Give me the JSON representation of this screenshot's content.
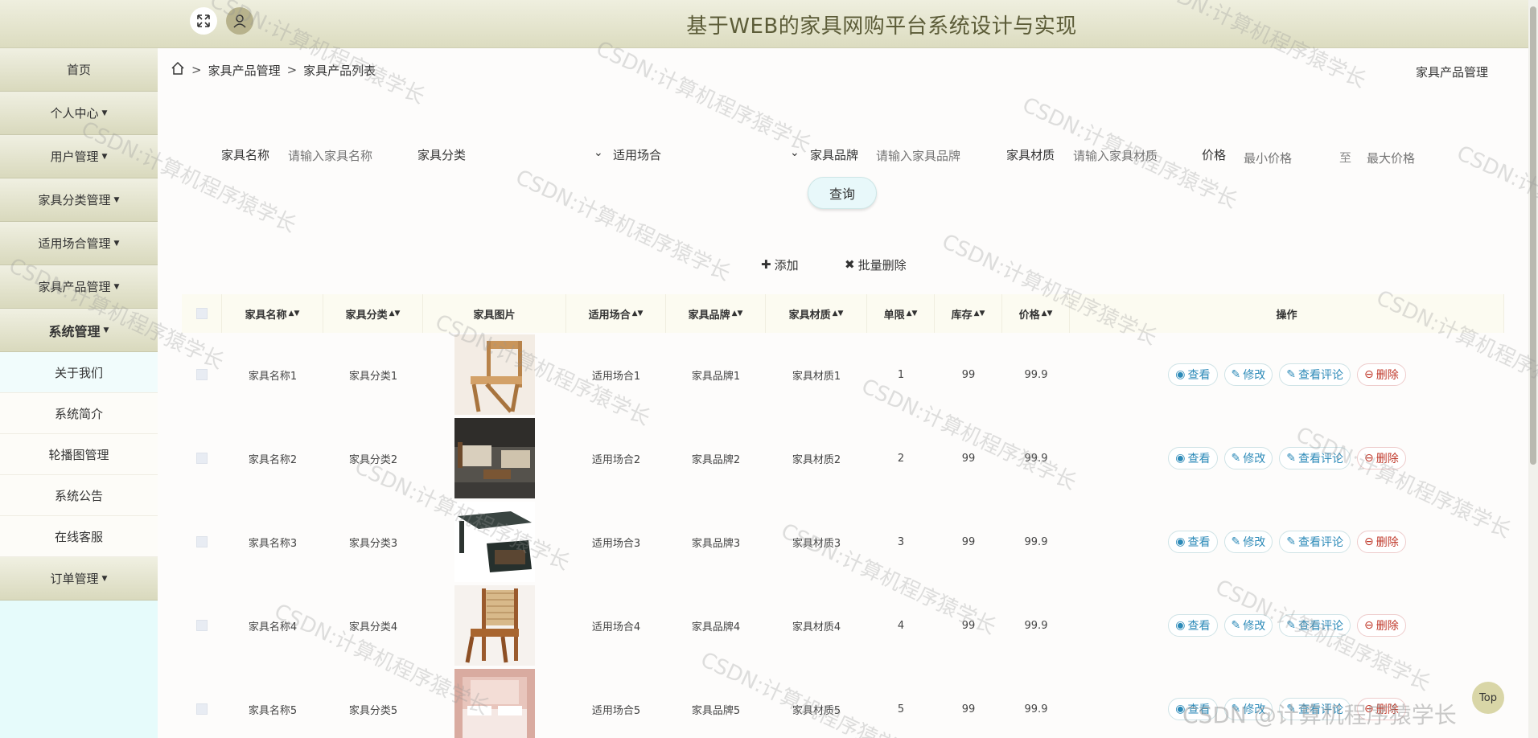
{
  "header": {
    "title": "基于WEB的家具网购平台系统设计与实现"
  },
  "sidebar": {
    "items": [
      {
        "label": "首页",
        "caret": ""
      },
      {
        "label": "个人中心",
        "caret": "▼"
      },
      {
        "label": "用户管理",
        "caret": "▼"
      },
      {
        "label": "家具分类管理",
        "caret": "▼"
      },
      {
        "label": "适用场合管理",
        "caret": "▼"
      },
      {
        "label": "家具产品管理",
        "caret": "▼"
      },
      {
        "label": "系统管理",
        "caret": "▼"
      }
    ],
    "sub_items": [
      "关于我们",
      "系统简介",
      "轮播图管理",
      "系统公告",
      "在线客服"
    ],
    "last_item": {
      "label": "订单管理",
      "caret": "▼"
    }
  },
  "breadcrumb": {
    "level1": "家具产品管理",
    "level2": "家具产品列表",
    "sep": ">"
  },
  "page_name": "家具产品管理",
  "search": {
    "name_label": "家具名称",
    "name_placeholder": "请输入家具名称",
    "category_label": "家具分类",
    "occasion_label": "适用场合",
    "brand_label": "家具品牌",
    "brand_placeholder": "请输入家具品牌",
    "material_label": "家具材质",
    "material_placeholder": "请输入家具材质",
    "price_label": "价格",
    "min_placeholder": "最小价格",
    "to": "至",
    "max_placeholder": "最大价格",
    "query_label": "查询"
  },
  "actions": {
    "add_icon": "✚",
    "add_label": "添加",
    "batch_icon": "✖",
    "batch_label": "批量删除"
  },
  "table": {
    "headers": [
      "家具名称",
      "家具分类",
      "家具图片",
      "适用场合",
      "家具品牌",
      "家具材质",
      "单限",
      "库存",
      "价格",
      "操作"
    ],
    "rows": [
      {
        "name": "家具名称1",
        "category": "家具分类1",
        "occasion": "适用场合1",
        "brand": "家具品牌1",
        "material": "家具材质1",
        "limit": "1",
        "stock": "99",
        "price": "99.9",
        "image": "chair"
      },
      {
        "name": "家具名称2",
        "category": "家具分类2",
        "occasion": "适用场合2",
        "brand": "家具品牌2",
        "material": "家具材质2",
        "limit": "2",
        "stock": "99",
        "price": "99.9",
        "image": "sofa"
      },
      {
        "name": "家具名称3",
        "category": "家具分类3",
        "occasion": "适用场合3",
        "brand": "家具品牌3",
        "material": "家具材质3",
        "limit": "3",
        "stock": "99",
        "price": "99.9",
        "image": "desk"
      },
      {
        "name": "家具名称4",
        "category": "家具分类4",
        "occasion": "适用场合4",
        "brand": "家具品牌4",
        "material": "家具材质4",
        "limit": "4",
        "stock": "99",
        "price": "99.9",
        "image": "cane-chair"
      },
      {
        "name": "家具名称5",
        "category": "家具分类5",
        "occasion": "适用场合5",
        "brand": "家具品牌5",
        "material": "家具材质5",
        "limit": "5",
        "stock": "99",
        "price": "99.9",
        "image": "bed"
      }
    ],
    "ops": {
      "view": "查看",
      "edit": "修改",
      "review": "查看评论",
      "delete": "删除"
    }
  },
  "top_button": "Top",
  "watermark": "CSDN:计算机程序猿学长",
  "watermark_footer": "CSDN @计算机程序猿学长"
}
